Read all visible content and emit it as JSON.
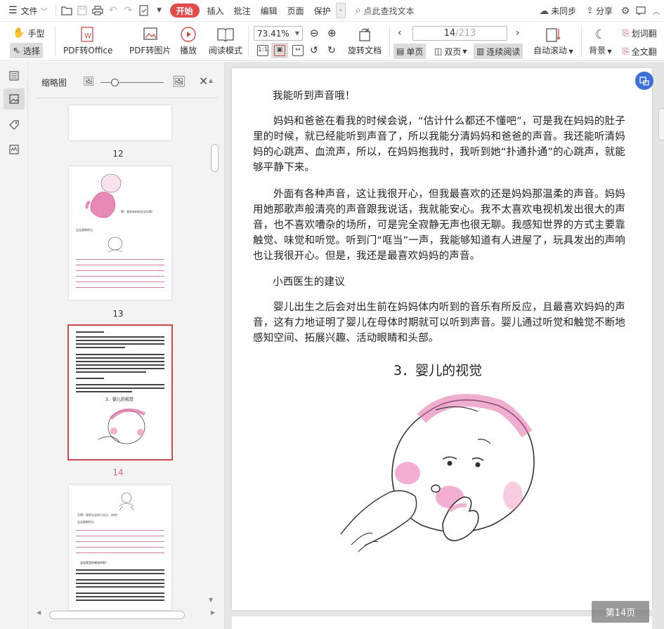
{
  "menubar": {
    "file_label": "文件",
    "tabs": [
      "开始",
      "插入",
      "批注",
      "编辑",
      "页面",
      "保护"
    ],
    "search_text": "点此查找文本",
    "sync_label": "未同步",
    "share_label": "分享"
  },
  "toolbar": {
    "hand_label": "手型",
    "select_label": "选择",
    "pdf_to_office": "PDF转Office",
    "pdf_to_image": "PDF转图片",
    "play_label": "播放",
    "read_mode": "阅读模式",
    "zoom_value": "73.41%",
    "rotate_doc": "旋转文档",
    "page_current": "14",
    "page_total": "/213",
    "single_page": "单页",
    "double_page": "双页",
    "continuous": "连续阅读",
    "auto_scroll": "自动滚动",
    "background": "背景",
    "word_pick": "划词翻",
    "full_text": "全文翻"
  },
  "thumbnail_panel": {
    "title": "缩略图",
    "pages": [
      {
        "num": "12"
      },
      {
        "num": "13",
        "caption": "嗯！我爸爸妈妈在说话哦！",
        "label": "宝宝星期的记"
      },
      {
        "num": "14",
        "heading": "3．婴儿的视觉"
      },
      {
        "num": "",
        "caption": "天啊！我是宝宝的小宝贝，哈哈！",
        "label": "宝宝星期的记",
        "section": "宝宝是怎样感觉的呢？"
      }
    ]
  },
  "document": {
    "paragraphs": [
      "我能听到声音哦！",
      "妈妈和爸爸在看我的时候会说，“估计什么都还不懂吧”，可是我在妈妈的肚子里的时候，就已经能听到声音了，所以我能分清妈妈和爸爸的声音。我还能听清妈妈的心跳声、血流声，所以，在妈妈抱我时，我听到她“扑通扑通”的心跳声，就能够平静下来。",
      "外面有各种声音，这让我很开心，但我最喜欢的还是妈妈那温柔的声音。妈妈用她那歌声般清亮的声音跟我说话，我就能安心。我不太喜欢电视机发出很大的声音，也不喜欢嘈杂的场所，可是完全寂静无声也很无聊。我感知世界的方式主要靠触觉、味觉和听觉。听到门“哐当”一声，我能够知道有人进屋了，玩具发出的声响也让我很开心。但是，我还是最喜欢妈妈的声音。",
      "小西医生的建议",
      "婴儿出生之后会对出生前在妈妈体内听到的音乐有所反应，且最喜欢妈妈的声音，这有力地证明了婴儿在母体时期就可以听到声音。婴儿通过听觉和触觉不断地感知空间、拓展兴趣、活动眼睛和头部。"
    ],
    "heading": "3．婴儿的视觉",
    "page_indicator": "第14页"
  },
  "colors": {
    "accent_red": "#e04b4b",
    "thumb_selected": "#c94b4b",
    "current_page_num": "#e06c7f",
    "float_button": "#3d6fd8"
  }
}
